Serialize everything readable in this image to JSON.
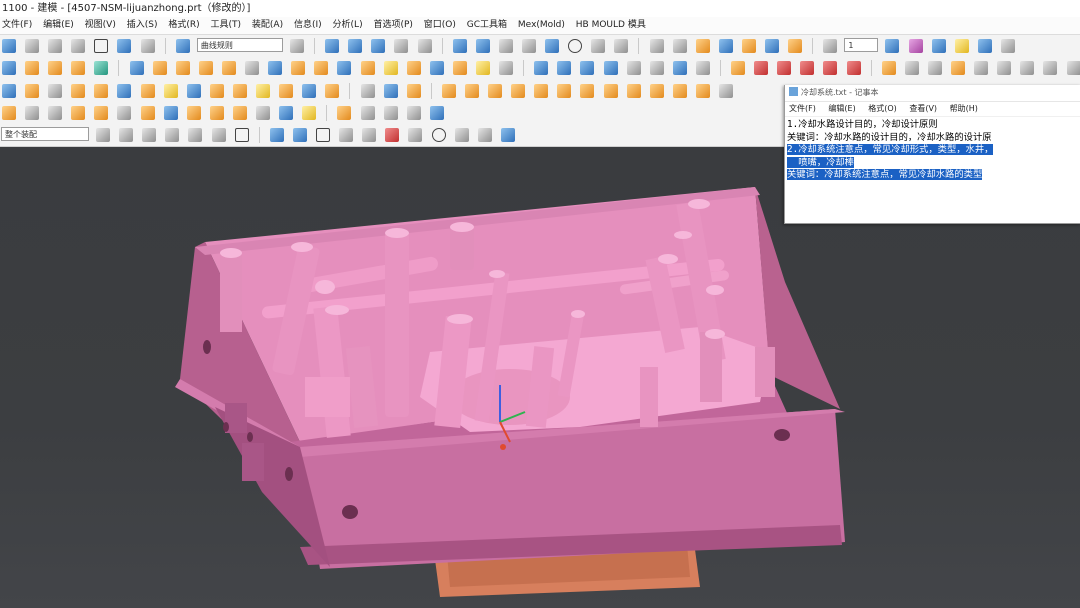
{
  "window": {
    "title": "1100 - 建模 - [4507-NSM-lijuanzhong.prt（修改的）]"
  },
  "menu": [
    "文件(F)",
    "编辑(E)",
    "视图(V)",
    "插入(S)",
    "格式(R)",
    "工具(T)",
    "装配(A)",
    "信息(I)",
    "分析(L)",
    "首选项(P)",
    "窗口(O)",
    "GC工具箱",
    "Mex(Mold)",
    "HB MOULD 模具"
  ],
  "toolbar": {
    "filter_value": "曲线规则",
    "layer_value": "1",
    "select_scope": "整个装配"
  },
  "notepad": {
    "title": "冷却系统.txt - 记事本",
    "menu": [
      "文件(F)",
      "编辑(E)",
      "格式(O)",
      "查看(V)",
      "帮助(H)"
    ],
    "lines": [
      "1.冷却水路设计目的，冷却设计原则",
      "关键词：冷却水路的设计目的，冷却水路的设计原",
      "2.冷却系统注意点，常见冷却形式，类型，水井，",
      "  喷嘴，冷却棒",
      "关键词：冷却系统注意点，常见冷却水路的类型"
    ]
  },
  "colors": {
    "mold_top": "#cf79aa",
    "mold_side": "#c1669a",
    "mold_front": "#b7608f",
    "mold_interior": "#ef9cc8",
    "selection": "#1b61c4",
    "background": "#3b3d40"
  }
}
